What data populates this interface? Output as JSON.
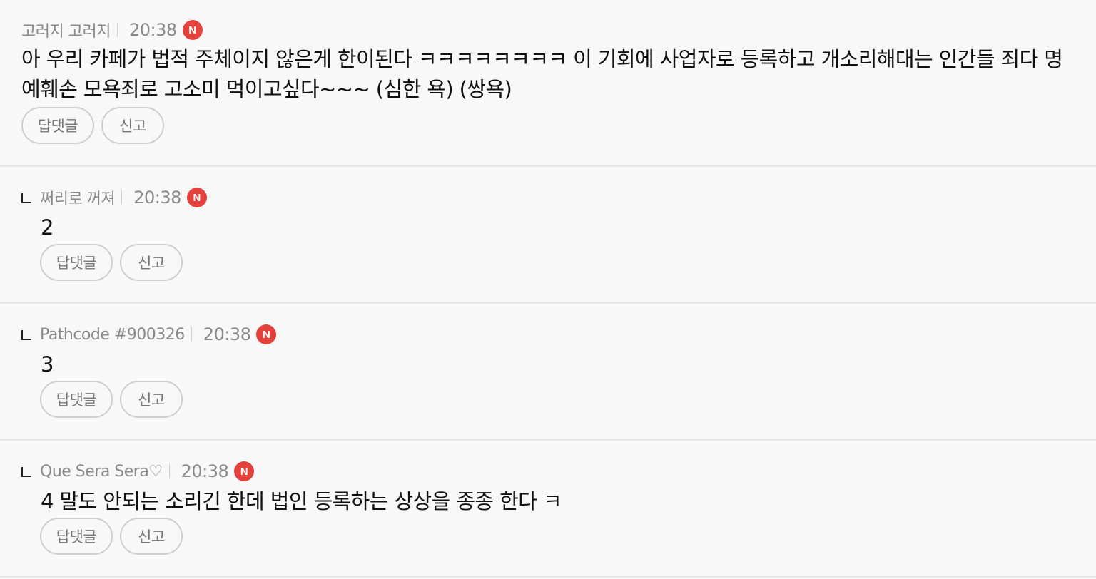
{
  "comments": [
    {
      "author": "고러지 고러지",
      "time": "20:38",
      "badge": "N",
      "text": "아 우리 카페가 법적 주체이지 않은게 한이된다 ㅋㅋㅋㅋㅋㅋㅋㅋ 이 기회에 사업자로 등록하고 개소리해대는 인간들 죄다 명예훼손 모욕죄로 고소미 먹이고싶다~~~ (심한 욕) (쌍욕)",
      "reply_label": "답댓글",
      "report_label": "신고"
    },
    {
      "author": "쩌리로 꺼져",
      "time": "20:38",
      "badge": "N",
      "text": "2",
      "reply_label": "답댓글",
      "report_label": "신고"
    },
    {
      "author": "Pathcode #900326",
      "time": "20:38",
      "badge": "N",
      "text": "3",
      "reply_label": "답댓글",
      "report_label": "신고"
    },
    {
      "author": "Que Sera Sera♡",
      "time": "20:38",
      "badge": "N",
      "text": "4 말도 안되는 소리긴 한데 법인 등록하는 상상을 종종 한다 ㅋ",
      "reply_label": "답댓글",
      "report_label": "신고"
    }
  ],
  "colors": {
    "background": "#f8f8f8",
    "badge": "#e2413c",
    "meta_text": "#8a8a8a",
    "divider": "#e6e6e6"
  }
}
